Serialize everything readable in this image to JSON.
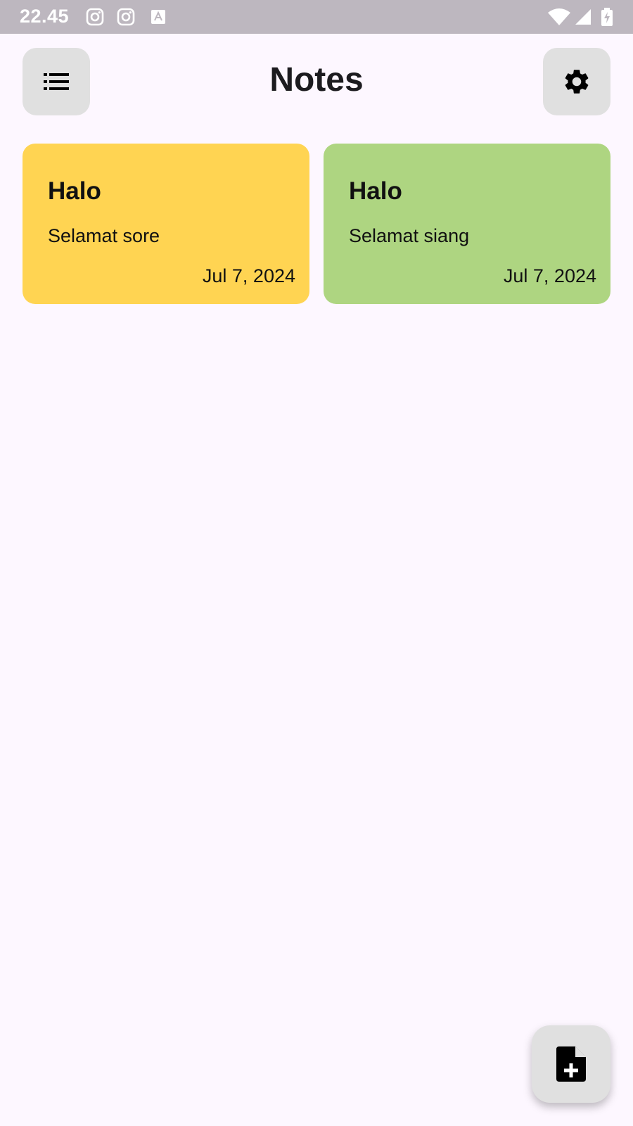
{
  "status_bar": {
    "time": "22.45",
    "icons": [
      "instagram-icon",
      "instagram-icon",
      "translate-icon",
      "wifi-icon",
      "signal-icon",
      "battery-charging-icon"
    ],
    "background": "#bdb7bf"
  },
  "header": {
    "title": "Notes",
    "menu_icon": "list-icon",
    "settings_icon": "gear-icon"
  },
  "notes": [
    {
      "title": "Halo",
      "body": "Selamat sore",
      "date": "Jul 7, 2024",
      "color": "#ffd452"
    },
    {
      "title": "Halo",
      "body": "Selamat siang",
      "date": "Jul 7, 2024",
      "color": "#aed581"
    }
  ],
  "fab": {
    "icon": "new-note-icon"
  },
  "colors": {
    "background": "#fdf7ff",
    "button": "#e0e0e0",
    "text": "#1c1b1f"
  }
}
